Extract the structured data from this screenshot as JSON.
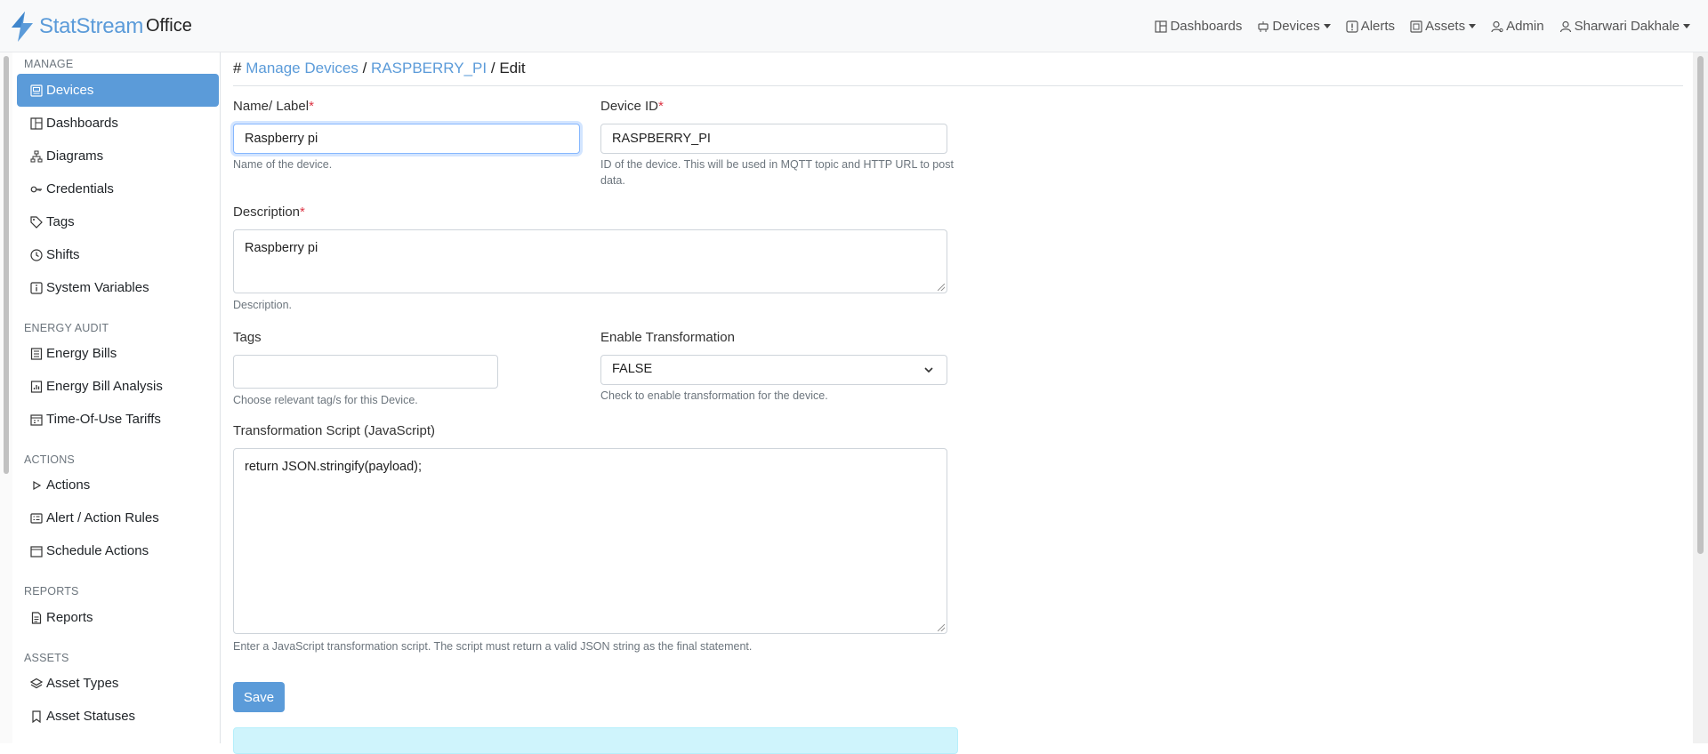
{
  "brand": {
    "name": "StatStream",
    "workspace": "Office",
    "accent": "#5b9bd9"
  },
  "nav": {
    "dashboards": "Dashboards",
    "devices": "Devices",
    "alerts": "Alerts",
    "assets": "Assets",
    "admin": "Admin",
    "user": "Sharwari Dakhale"
  },
  "sidebar": {
    "manage": {
      "title": "MANAGE",
      "items": [
        {
          "label": "Devices"
        },
        {
          "label": "Dashboards"
        },
        {
          "label": "Diagrams"
        },
        {
          "label": "Credentials"
        },
        {
          "label": "Tags"
        },
        {
          "label": "Shifts"
        },
        {
          "label": "System Variables"
        }
      ]
    },
    "energy": {
      "title": "ENERGY AUDIT",
      "items": [
        {
          "label": "Energy Bills"
        },
        {
          "label": "Energy Bill Analysis"
        },
        {
          "label": "Time-Of-Use Tariffs"
        }
      ]
    },
    "actions": {
      "title": "ACTIONS",
      "items": [
        {
          "label": "Actions"
        },
        {
          "label": "Alert / Action Rules"
        },
        {
          "label": "Schedule Actions"
        }
      ]
    },
    "reports": {
      "title": "REPORTS",
      "items": [
        {
          "label": "Reports"
        }
      ]
    },
    "assets": {
      "title": "ASSETS",
      "items": [
        {
          "label": "Asset Types"
        },
        {
          "label": "Asset Statuses"
        }
      ]
    }
  },
  "breadcrumb": {
    "hash": "#",
    "manage": "Manage Devices",
    "sep": "/",
    "device": "RASPBERRY_PI",
    "current": "Edit"
  },
  "form": {
    "name": {
      "label": "Name/ Label",
      "required": "*",
      "value": "Raspberry pi",
      "help": "Name of the device."
    },
    "device_id": {
      "label": "Device ID",
      "required": "*",
      "value": "RASPBERRY_PI",
      "help": "ID of the device. This will be used in MQTT topic and HTTP URL to post data."
    },
    "description": {
      "label": "Description",
      "required": "*",
      "value": "Raspberry pi",
      "help": "Description."
    },
    "tags": {
      "label": "Tags",
      "value": "",
      "help": "Choose relevant tag/s for this Device."
    },
    "transform": {
      "label": "Enable Transformation",
      "value": "FALSE",
      "help": "Check to enable transformation for the device."
    },
    "script": {
      "label": "Transformation Script (JavaScript)",
      "value": "return JSON.stringify(payload);",
      "help": "Enter a JavaScript transformation script. The script must return a valid JSON string as the final statement."
    },
    "save_label": "Save"
  }
}
